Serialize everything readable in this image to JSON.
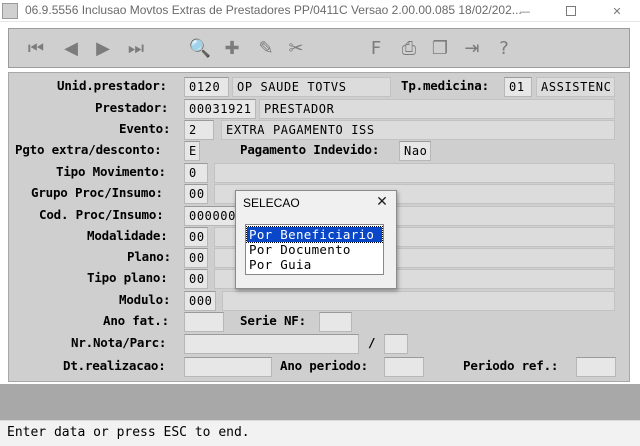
{
  "window": {
    "title": "06.9.5556  Inclusao  Movtos Extras de Prestadores PP/0411C Versao 2.00.00.085 18/02/202...",
    "min_glyph": "—",
    "close_glyph": "✕"
  },
  "toolbar": {
    "first": "⏮",
    "prev": "◀",
    "next": "▶",
    "last": "⏭",
    "search": "🔍",
    "add": "✚",
    "edit": "✎",
    "delete": "✂",
    "form": "F",
    "print": "⎙",
    "copy": "❐",
    "exit": "⇥",
    "help": "?"
  },
  "form": {
    "unid_prestador": {
      "label": "Unid.prestador:",
      "code": "0120",
      "name": "OP SAUDE TOTVS"
    },
    "tp_medicina": {
      "label": "Tp.medicina:",
      "code": "01",
      "name": "ASSISTENC"
    },
    "prestador": {
      "label": "Prestador:",
      "code": "00031921",
      "name": "PRESTADOR"
    },
    "evento": {
      "label": "Evento:",
      "code": "2",
      "name": "EXTRA PAGAMENTO ISS"
    },
    "pgto": {
      "label": "Pgto extra/desconto:",
      "value": "E"
    },
    "pagamento_indevido": {
      "label": "Pagamento Indevido:",
      "value": "Nao"
    },
    "tipo_movimento": {
      "label": "Tipo Movimento:",
      "value": "0"
    },
    "grupo_proc": {
      "label": "Grupo Proc/Insumo:",
      "value": "00"
    },
    "cod_proc": {
      "label": "Cod. Proc/Insumo:",
      "value": "00000000"
    },
    "modalidade": {
      "label": "Modalidade:",
      "value": "00"
    },
    "plano": {
      "label": "Plano:",
      "value": "00"
    },
    "tipo_plano": {
      "label": "Tipo plano:",
      "value": "00"
    },
    "modulo": {
      "label": "Modulo:",
      "value": "000"
    },
    "ano_fat": {
      "label": "Ano fat.:",
      "value": ""
    },
    "serie_nf": {
      "label": "Serie NF:",
      "value": ""
    },
    "nr_nota": {
      "label": "Nr.Nota/Parc:",
      "separator": "/",
      "value": "",
      "parc": ""
    },
    "dt_realizacao": {
      "label": "Dt.realizacao:",
      "value": ""
    },
    "ano_periodo": {
      "label": "Ano periodo:",
      "value": ""
    },
    "periodo_ref": {
      "label": "Periodo ref.:",
      "value": ""
    }
  },
  "popup": {
    "title": "SELECAO",
    "close_glyph": "✕",
    "options": [
      "Por Beneficiario",
      "Por Documento",
      "Por Guia"
    ],
    "selected": "Por Beneficiario"
  },
  "status": {
    "text": "Enter data or press ESC to end."
  }
}
